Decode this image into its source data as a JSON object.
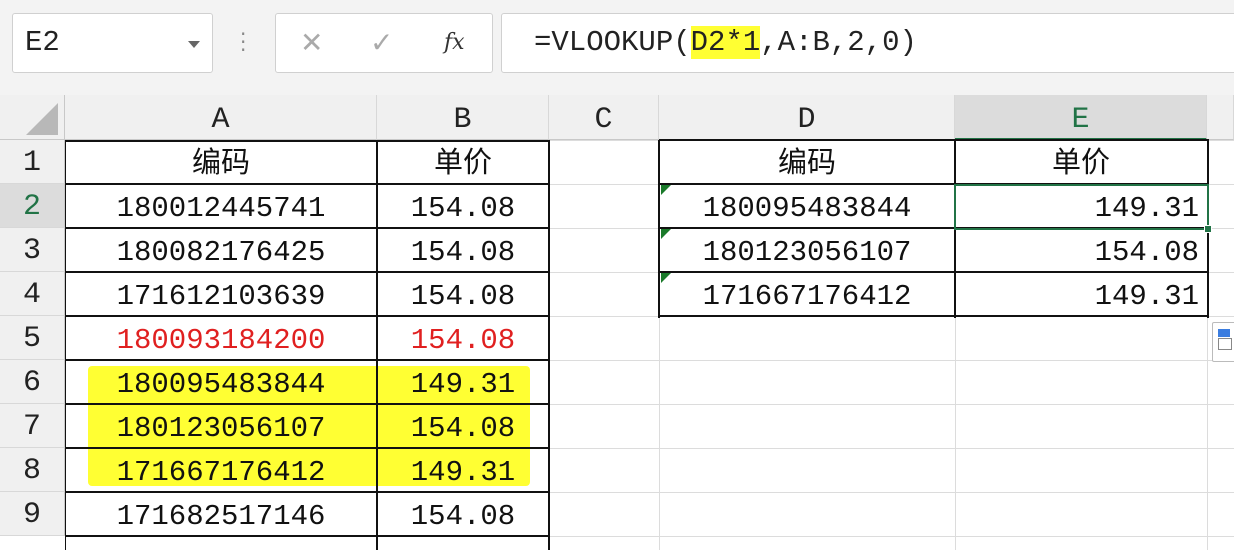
{
  "formula_bar": {
    "name_box": "E2",
    "cancel_icon": "✕",
    "enter_icon": "✓",
    "fx_label": "fx",
    "formula_prefix": "=VLOOKUP(",
    "formula_highlight": "D2*1",
    "formula_suffix": ",A:B,2,0)"
  },
  "columns": [
    "A",
    "B",
    "C",
    "D",
    "E"
  ],
  "rows": [
    "1",
    "2",
    "3",
    "4",
    "5",
    "6",
    "7",
    "8",
    "9"
  ],
  "table_left": {
    "headers": [
      "编码",
      "单价"
    ],
    "rows": [
      [
        "180012445741",
        "154.08"
      ],
      [
        "180082176425",
        "154.08"
      ],
      [
        "171612103639",
        "154.08"
      ],
      [
        "180093184200",
        "154.08"
      ],
      [
        "180095483844",
        "149.31"
      ],
      [
        "180123056107",
        "154.08"
      ],
      [
        "171667176412",
        "149.31"
      ],
      [
        "171682517146",
        "154.08"
      ]
    ]
  },
  "table_right": {
    "headers": [
      "编码",
      "单价"
    ],
    "rows": [
      [
        "180095483844",
        "149.31"
      ],
      [
        "180123056107",
        "154.08"
      ],
      [
        "171667176412",
        "149.31"
      ]
    ]
  },
  "colors": {
    "selection": "#217346",
    "highlight": "#ffff33",
    "red_text": "#e02020"
  }
}
